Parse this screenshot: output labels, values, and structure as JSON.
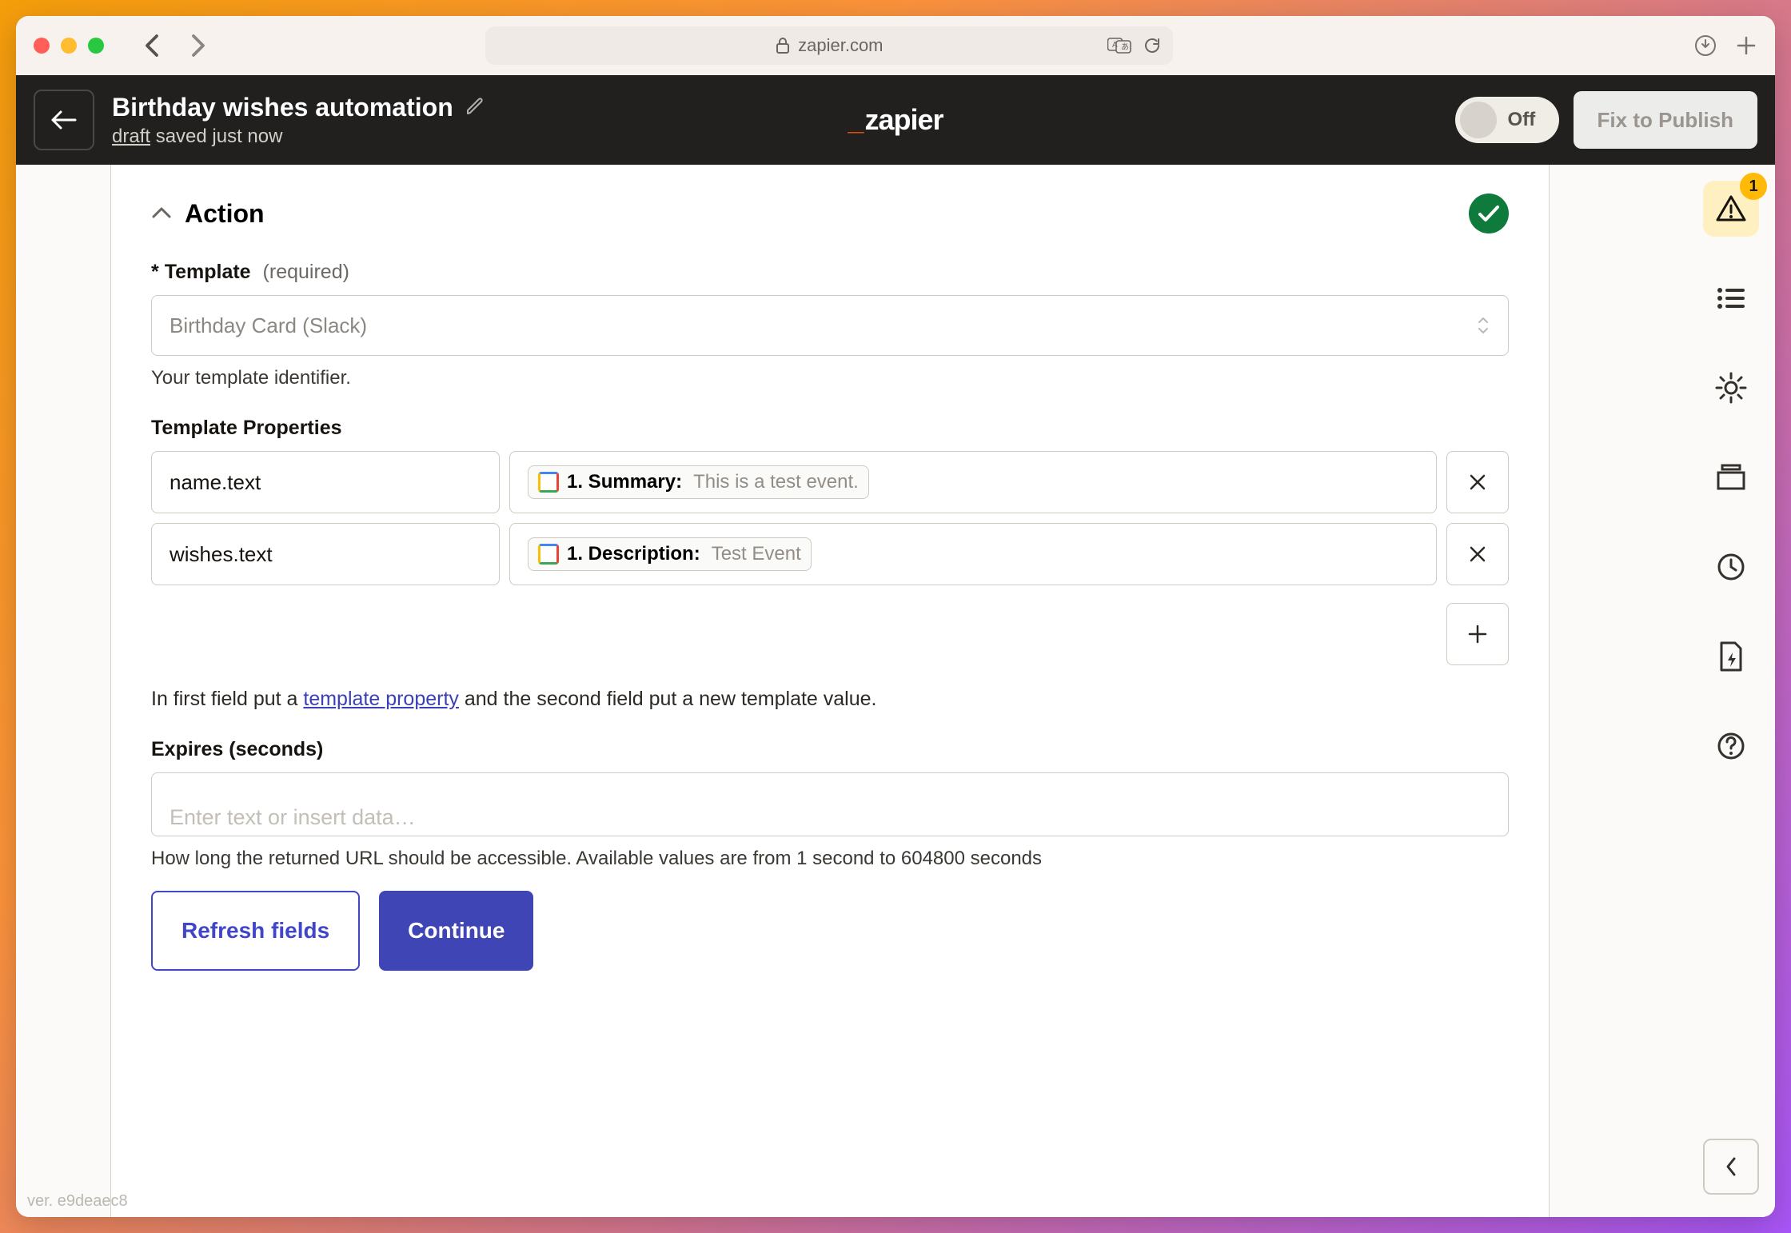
{
  "browser": {
    "url_host": "zapier.com"
  },
  "header": {
    "title": "Birthday wishes automation",
    "status_draft": "draft",
    "status_rest": " saved just now",
    "logo": "zapier",
    "toggle_label": "Off",
    "publish_btn": "Fix to Publish"
  },
  "section": {
    "title": "Action"
  },
  "template_field": {
    "label_required": "*",
    "label": "Template",
    "hint": "(required)",
    "value": "Birthday Card (Slack)",
    "help": "Your template identifier."
  },
  "props": {
    "label": "Template Properties",
    "rows": [
      {
        "key": "name.text",
        "token_label": "1. Summary:",
        "token_value": "This is a test event."
      },
      {
        "key": "wishes.text",
        "token_label": "1. Description:",
        "token_value": "Test Event"
      }
    ],
    "help_pre": "In first field put a ",
    "help_link": "template property",
    "help_post": " and the second field put a new template value."
  },
  "expires": {
    "label": "Expires (seconds)",
    "placeholder": "Enter text or insert data…",
    "help": "How long the returned URL should be accessible. Available values are from 1 second to 604800 seconds"
  },
  "buttons": {
    "refresh": "Refresh fields",
    "continue": "Continue"
  },
  "rail": {
    "badge_count": "1"
  },
  "version": "ver. e9deaec8"
}
